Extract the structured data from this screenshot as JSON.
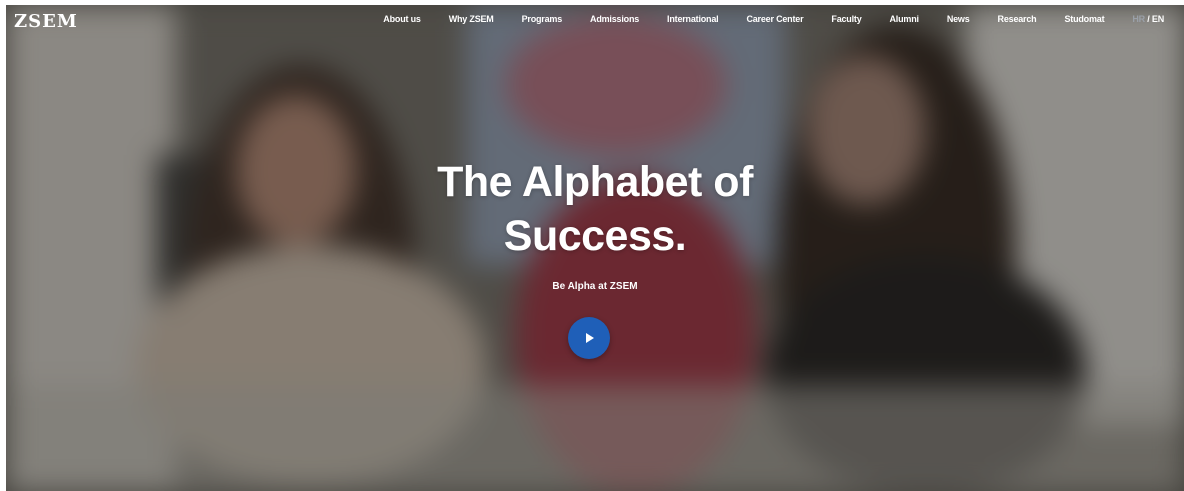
{
  "logo": {
    "text": "ZSEM"
  },
  "nav": {
    "items": [
      {
        "label": "About us"
      },
      {
        "label": "Why ZSEM"
      },
      {
        "label": "Programs"
      },
      {
        "label": "Admissions"
      },
      {
        "label": "International"
      },
      {
        "label": "Career Center"
      },
      {
        "label": "Faculty"
      },
      {
        "label": "Alumni"
      },
      {
        "label": "News"
      },
      {
        "label": "Research"
      },
      {
        "label": "Studomat"
      }
    ],
    "language": {
      "inactive": "HR",
      "separator": " / ",
      "active": "EN"
    }
  },
  "hero": {
    "title_line1": "The Alphabet of",
    "title_line2": "Success.",
    "tagline": "Be Alpha at ZSEM",
    "play_icon": "play-icon",
    "accent_color": "#1f5fb8"
  }
}
